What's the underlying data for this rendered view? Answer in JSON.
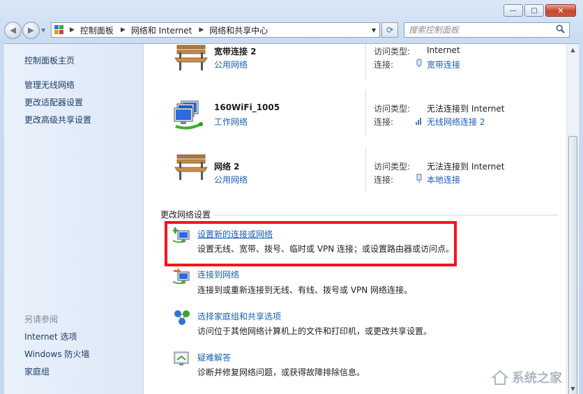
{
  "window": {
    "minimize_glyph": "—",
    "maximize_glyph": "□",
    "close_glyph": "✕"
  },
  "address": {
    "crumbs": [
      "控制面板",
      "网络和 Internet",
      "网络和共享中心"
    ],
    "search_placeholder": "搜索控制面板"
  },
  "sidebar": {
    "home": "控制面板主页",
    "links": [
      "管理无线网络",
      "更改适配器设置",
      "更改高级共享设置"
    ],
    "see_also_title": "另请参阅",
    "see_also": [
      "Internet 选项",
      "Windows 防火墙",
      "家庭组"
    ]
  },
  "networks": [
    {
      "name": "宽带连接  2",
      "category": "公用网络",
      "icon": "park-bench-icon",
      "access_key": "访问类型:",
      "access_value": "Internet",
      "conn_key": "连接:",
      "conn_value": "宽带连接",
      "conn_icon": "dialup-icon"
    },
    {
      "name": "160WiFi_1005",
      "category": "工作网络",
      "icon": "work-network-icon",
      "access_key": "访问类型:",
      "access_value": "无法连接到 Internet",
      "conn_key": "连接:",
      "conn_value": "无线网络连接 2",
      "conn_icon": "wireless-signal-icon"
    },
    {
      "name": "网络  2",
      "category": "公用网络",
      "icon": "park-bench-icon",
      "access_key": "访问类型:",
      "access_value": "无法连接到 Internet",
      "conn_key": "连接:",
      "conn_value": "本地连接",
      "conn_icon": "ethernet-icon"
    }
  ],
  "change_settings": {
    "title": "更改网络设置",
    "tasks": [
      {
        "link": "设置新的连接或网络",
        "desc": "设置无线、宽带、拨号、临时或 VPN 连接；或设置路由器或访问点。",
        "icon": "new-connection-icon"
      },
      {
        "link": "连接到网络",
        "desc": "连接到或重新连接到无线、有线、拨号或 VPN 网络连接。",
        "icon": "connect-network-icon"
      },
      {
        "link": "选择家庭组和共享选项",
        "desc": "访问位于其他网络计算机上的文件和打印机，或更改共享设置。",
        "icon": "homegroup-icon"
      },
      {
        "link": "疑难解答",
        "desc": "诊断并修复网络问题，或获得故障排除信息。",
        "icon": "troubleshoot-icon"
      }
    ]
  },
  "watermark": {
    "text": "系统之家"
  },
  "colors": {
    "link": "#1a5fb4",
    "highlight": "#f4141e"
  }
}
